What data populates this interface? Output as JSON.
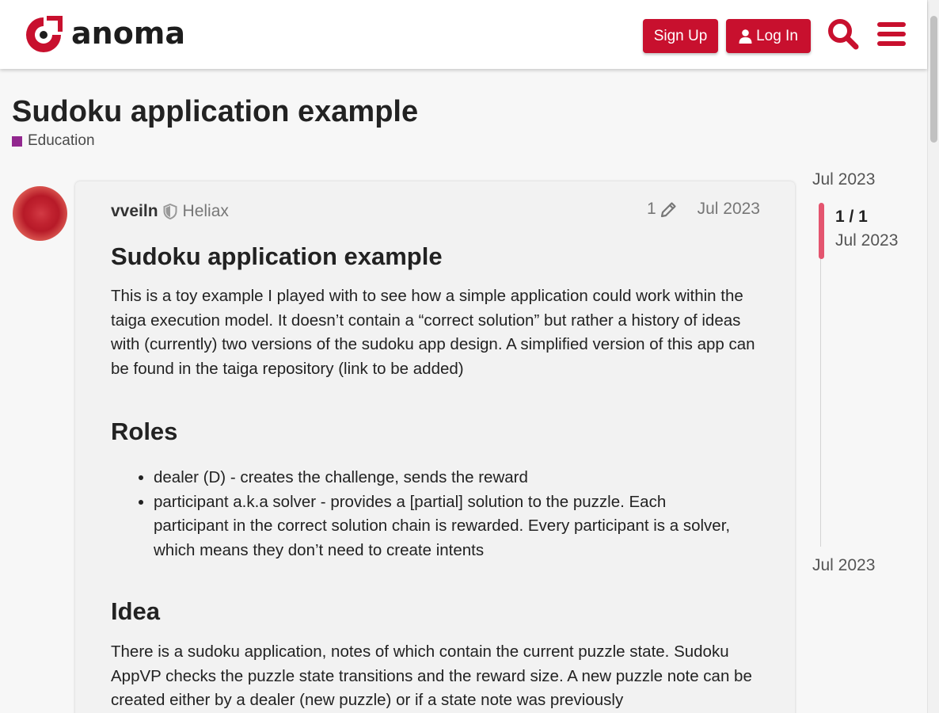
{
  "header": {
    "logo_text": "anoma",
    "signup_label": "Sign Up",
    "login_label": "Log In",
    "accent_color": "#c8102e"
  },
  "topic": {
    "title": "Sudoku application example",
    "category": "Education",
    "category_color": "#92278f"
  },
  "post": {
    "username": "vveiln",
    "user_title": "Heliax",
    "edit_count": "1",
    "date": "Jul 2023",
    "heading": "Sudoku application example",
    "intro": "This is a toy example I played with to see how a simple application could work within the taiga execution model. It doesn’t contain a “correct solution” but rather a history of ideas with (currently) two versions of the sudoku app design. A simplified version of this app can be found in the taiga repository (link to be added)",
    "roles_heading": "Roles",
    "roles": [
      "dealer (D) - creates the challenge, sends the reward",
      "participant a.k.a solver - provides a [partial] solution to the puzzle. Each participant in the correct solution chain is rewarded. Every participant is a solver, which means they don’t need to create intents"
    ],
    "idea_heading": "Idea",
    "idea_text": "There is a sudoku application, notes of which contain the current puzzle state. Sudoku AppVP checks the puzzle state transitions and the reward size. A new puzzle note can be created either by a dealer (new puzzle) or if a state note was previously"
  },
  "timeline": {
    "top_date": "Jul 2023",
    "position": "1 / 1",
    "current_date": "Jul 2023",
    "bottom_date": "Jul 2023"
  }
}
